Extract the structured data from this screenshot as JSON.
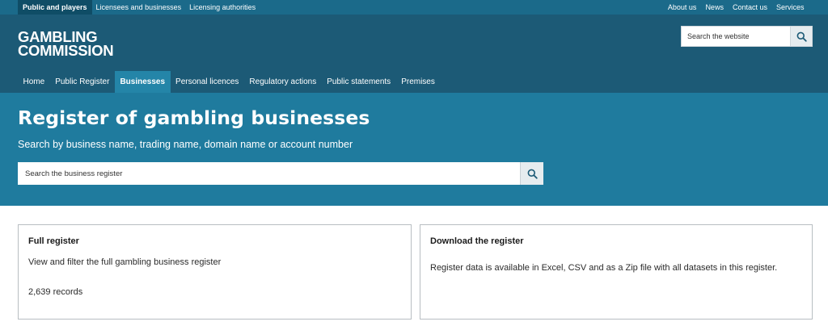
{
  "topbar": {
    "left": [
      "Public and players",
      "Licensees and businesses",
      "Licensing authorities"
    ],
    "right": [
      "About us",
      "News",
      "Contact us",
      "Services"
    ]
  },
  "logo": {
    "line1": "GAMBLING",
    "line2": "COMMISSION"
  },
  "site_search": {
    "placeholder": "Search the website"
  },
  "nav": [
    "Home",
    "Public Register",
    "Businesses",
    "Personal licences",
    "Regulatory actions",
    "Public statements",
    "Premises"
  ],
  "hero": {
    "title": "Register of gambling businesses",
    "subtitle": "Search by business name, trading name, domain name or account number",
    "search_placeholder": "Search the business register"
  },
  "cards": {
    "full": {
      "title": "Full register",
      "desc": "View and filter the full gambling business register",
      "count": "2,639 records"
    },
    "download": {
      "title": "Download the register",
      "desc": "Register data is available in Excel, CSV and as a Zip file with all datasets in this register."
    }
  },
  "colors": {
    "topbar": "#1b6a8a",
    "header": "#1c5a76",
    "hero": "#1f7b9e",
    "active_nav": "#2485a8"
  },
  "icons": {
    "search": "search-icon"
  }
}
